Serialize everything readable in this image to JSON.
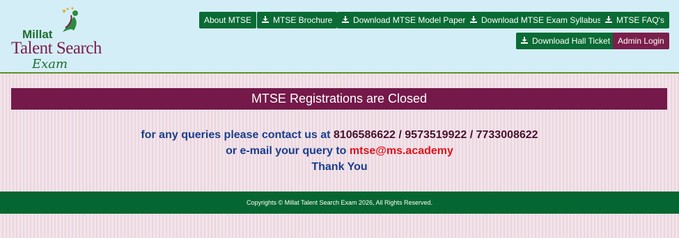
{
  "logo": {
    "line1": "Millat",
    "line2": "Talent Search",
    "line3": "Exam"
  },
  "nav": {
    "about": "About MTSE",
    "brochure": "MTSE Brochure",
    "model_paper": "Download MTSE Model Paper",
    "syllabus": "Download MTSE Exam Syllabus",
    "faqs": "MTSE FAQ's",
    "hall_ticket": "Download Hall Ticket",
    "admin_login": "Admin Login"
  },
  "banner": "MTSE Registrations are Closed",
  "contact": {
    "line1_prefix": "for any queries please contact us at ",
    "phones": "8106586622 / 9573519922 / 7733008622",
    "line2_prefix": "or e-mail your query to ",
    "email": "mtse@ms.academy",
    "thanks": "Thank You"
  },
  "footer": "Copyrights © Millat Talent Search Exam 2026, All Rights Reserved.",
  "colors": {
    "header_bg": "#d4eef8",
    "button_green": "#0a6b34",
    "button_maroon": "#7a1f4b",
    "banner_bg": "#74194a",
    "text_blue": "#1a3e8c",
    "email_red": "#e0121a",
    "footer_bg": "#066631"
  },
  "icons": [
    "download-icon",
    "logo-figure-icon"
  ]
}
